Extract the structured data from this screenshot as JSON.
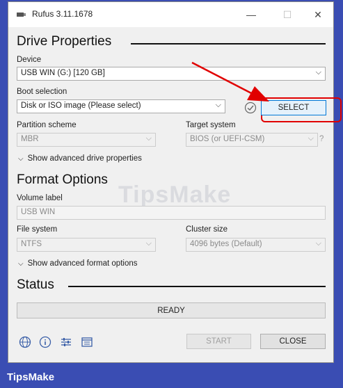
{
  "window": {
    "title": "Rufus 3.11.1678",
    "min_glyph": "—",
    "max_glyph": "☐",
    "close_glyph": "✕"
  },
  "drive_properties": {
    "heading": "Drive Properties",
    "device_label": "Device",
    "device_value": "USB WIN (G:) [120 GB]",
    "boot_label": "Boot selection",
    "boot_value": "Disk or ISO image (Please select)",
    "select_button": "SELECT",
    "partition_label": "Partition scheme",
    "partition_value": "MBR",
    "target_label": "Target system",
    "target_value": "BIOS (or UEFI-CSM)",
    "target_help": "?",
    "advanced_toggle": "Show advanced drive properties"
  },
  "format_options": {
    "heading": "Format Options",
    "volume_label": "Volume label",
    "volume_value": "USB WIN",
    "filesystem_label": "File system",
    "filesystem_value": "NTFS",
    "cluster_label": "Cluster size",
    "cluster_value": "4096 bytes (Default)",
    "advanced_toggle": "Show advanced format options"
  },
  "status": {
    "heading": "Status",
    "progress_text": "READY"
  },
  "bottom": {
    "icons": [
      "globe-icon",
      "info-icon",
      "settings-sliders-icon",
      "log-icon"
    ],
    "start_button": "START",
    "close_button": "CLOSE"
  },
  "watermark": "TipsMake",
  "footer_brand": "TipsMake",
  "colors": {
    "highlight": "#e10000",
    "accent": "#0078d7",
    "background": "#3a4db3"
  }
}
